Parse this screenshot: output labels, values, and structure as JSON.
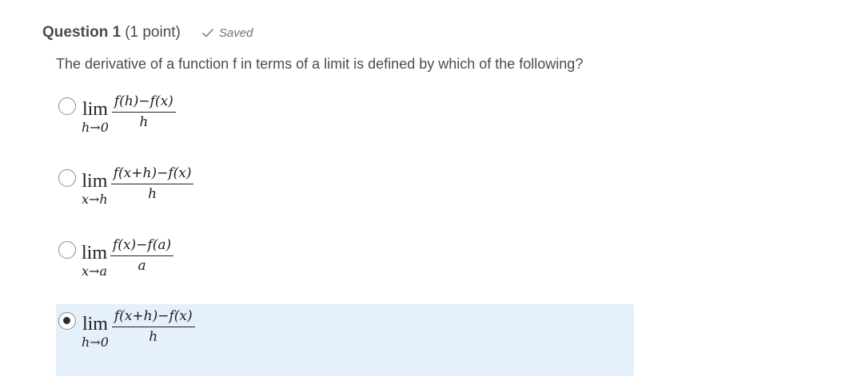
{
  "question": {
    "title": "Question 1",
    "points": "(1 point)",
    "saved_label": "Saved",
    "text": "The derivative of a function f in terms of a limit is defined by which of the following?"
  },
  "options": [
    {
      "lim": "lim",
      "sub": "h→0",
      "numerator": "f(h)−f(x)",
      "denominator": "h",
      "selected": false
    },
    {
      "lim": "lim",
      "sub": "x→h",
      "numerator": "f(x+h)−f(x)",
      "denominator": "h",
      "selected": false
    },
    {
      "lim": "lim",
      "sub": "x→a",
      "numerator": "f(x)−f(a)",
      "denominator": "a",
      "selected": false
    },
    {
      "lim": "lim",
      "sub": "h→0",
      "numerator": "f(x+h)−f(x)",
      "denominator": "h",
      "selected": true
    }
  ],
  "colors": {
    "selected_background": "#e6f0fb",
    "text": "#494c4e",
    "saved_text": "#6e7376"
  },
  "icons": {
    "saved": "checkmark-icon"
  }
}
